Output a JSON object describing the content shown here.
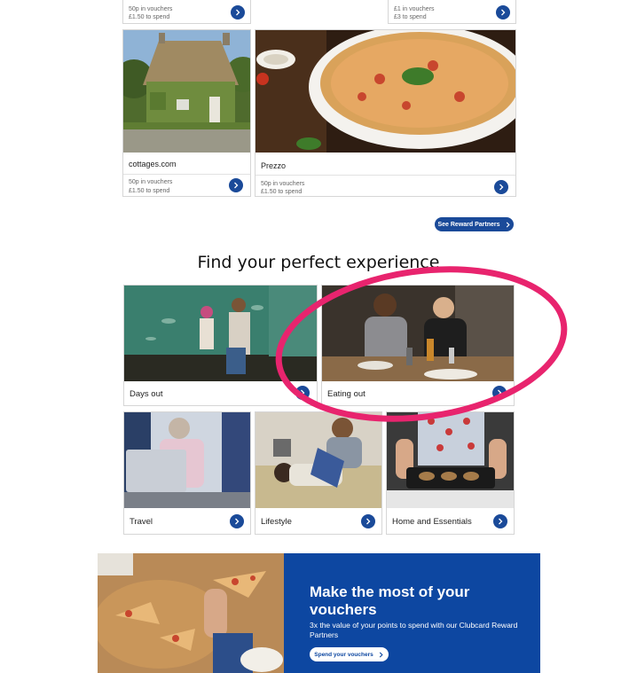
{
  "partners_top": [
    {
      "line1": "50p in vouchers",
      "line2": "£1.50 to spend"
    },
    {
      "line1": "£1 in vouchers",
      "line2": "£3 to spend"
    }
  ],
  "partners": [
    {
      "name": "cottages.com",
      "line1": "50p in vouchers",
      "line2": "£1.50 to spend"
    },
    {
      "name": "Prezzo",
      "line1": "50p in vouchers",
      "line2": "£1.50 to spend"
    }
  ],
  "see_partners_label": "See Reward Partners",
  "section_title": "Find your perfect experience",
  "experiences": [
    {
      "label": "Days out"
    },
    {
      "label": "Eating out"
    },
    {
      "label": "Travel"
    },
    {
      "label": "Lifestyle"
    },
    {
      "label": "Home and Essentials"
    }
  ],
  "banner": {
    "title": "Make the most of your vouchers",
    "description": "3x the value of your points to spend with our Clubcard Reward Partners",
    "cta": "Spend your vouchers"
  },
  "colors": {
    "brand_blue": "#1a4a99",
    "banner_blue": "#0d47a1",
    "highlight": "#e8246e"
  },
  "icons": {
    "arrow": "chevron-right-icon"
  }
}
